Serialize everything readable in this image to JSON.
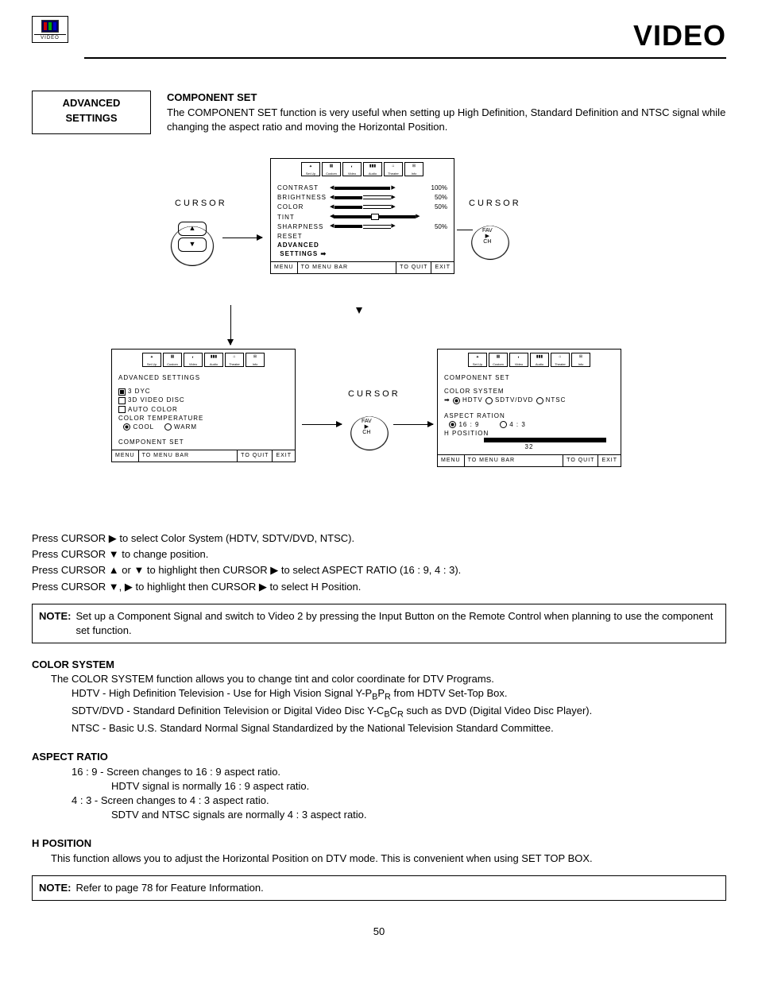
{
  "header": {
    "title": "VIDEO",
    "icon_label": "VIDEO"
  },
  "adv_settings_box": {
    "line1": "ADVANCED",
    "line2": "SETTINGS"
  },
  "component_set": {
    "heading": "COMPONENT SET",
    "desc": "The COMPONENT SET function is very useful when setting up High Definition, Standard Definition and NTSC signal while changing the aspect ratio and moving the Horizontal Position."
  },
  "diagram": {
    "cursor_label": "CURSOR",
    "fav": "FAV",
    "ch": "CH",
    "tabs": [
      "Set Up",
      "Custom",
      "Video",
      "Audio",
      "Theater",
      "Info"
    ],
    "panel1": {
      "rows": [
        {
          "label": "CONTRAST",
          "val": "100%",
          "fill": 100
        },
        {
          "label": "BRIGHTNESS",
          "val": "50%",
          "fill": 50
        },
        {
          "label": "COLOR",
          "val": "50%",
          "fill": 50
        },
        {
          "label": "TINT",
          "val": "",
          "fill": 50,
          "center": true
        },
        {
          "label": "SHARPNESS",
          "val": "50%",
          "fill": 50
        }
      ],
      "reset": "RESET",
      "adv": "ADVANCED",
      "settings": "SETTINGS",
      "menu": "MENU",
      "tomenu": "TO MENU BAR",
      "toquit": "TO QUIT",
      "exit": "EXIT"
    },
    "panel2": {
      "title": "ADVANCED SETTINGS",
      "i1": "3 DYC",
      "i2": "3D VIDEO DISC",
      "i3": "AUTO COLOR",
      "ct": "COLOR TEMPERATURE",
      "cool": "COOL",
      "warm": "WARM",
      "cs": "COMPONENT SET",
      "menu": "MENU",
      "tomenu": "TO MENU BAR",
      "toquit": "TO QUIT",
      "exit": "EXIT"
    },
    "panel3": {
      "title": "COMPONENT SET",
      "cs": "COLOR SYSTEM",
      "hdtv": "HDTV",
      "sdtv": "SDTV/DVD",
      "ntsc": "NTSC",
      "ar": "ASPECT RATION",
      "r169": "16 : 9",
      "r43": "4 : 3",
      "hp": "H POSITION",
      "hpval": "32",
      "menu": "MENU",
      "tomenu": "TO MENU BAR",
      "toquit": "TO QUIT",
      "exit": "EXIT"
    }
  },
  "instructions": [
    "Press CURSOR  ▶ to select Color System (HDTV, SDTV/DVD, NTSC).",
    "Press CURSOR ▼ to change position.",
    "Press CURSOR ▲ or ▼ to highlight then CURSOR  ▶ to select ASPECT RATIO (16 : 9, 4 : 3).",
    "Press CURSOR ▼, ▶ to highlight then CURSOR  ▶ to select H Position."
  ],
  "note1": {
    "label": "NOTE:",
    "text": "Set up a Component Signal and switch to Video 2 by pressing the Input Button on the Remote Control when planning to use the component set function."
  },
  "color_system": {
    "heading": "COLOR SYSTEM",
    "intro": "The COLOR SYSTEM function allows you to change tint and color coordinate for DTV Programs.",
    "hdtv_a": "HDTV - High Definition Television - Use for High Vision Signal Y-P",
    "hdtv_b": "B",
    "hdtv_c": "P",
    "hdtv_d": "R",
    "hdtv_e": " from HDTV Set-Top Box.",
    "sdtv_a": "SDTV/DVD - Standard  Definition Television or Digital Video Disc Y-C",
    "sdtv_b": "B",
    "sdtv_c": "C",
    "sdtv_d": "R",
    "sdtv_e": " such as DVD (Digital Video Disc Player).",
    "ntsc": "NTSC - Basic U.S. Standard Normal Signal Standardized by the National Television Standard Committee."
  },
  "aspect_ratio": {
    "heading": "ASPECT RATIO",
    "l1": "16 : 9 - Screen changes to 16 : 9 aspect ratio.",
    "l2": "HDTV signal is normally 16 : 9 aspect ratio.",
    "l3": "4 : 3 -  Screen changes to 4 : 3 aspect ratio.",
    "l4": "SDTV and NTSC signals are normally 4 : 3 aspect ratio."
  },
  "h_position": {
    "heading": "H POSITION",
    "text": "This function allows you to adjust the Horizontal Position on DTV mode. This is convenient when using SET TOP BOX."
  },
  "note2": {
    "label": "NOTE:",
    "text": "Refer to page 78 for Feature Information."
  },
  "page": "50"
}
